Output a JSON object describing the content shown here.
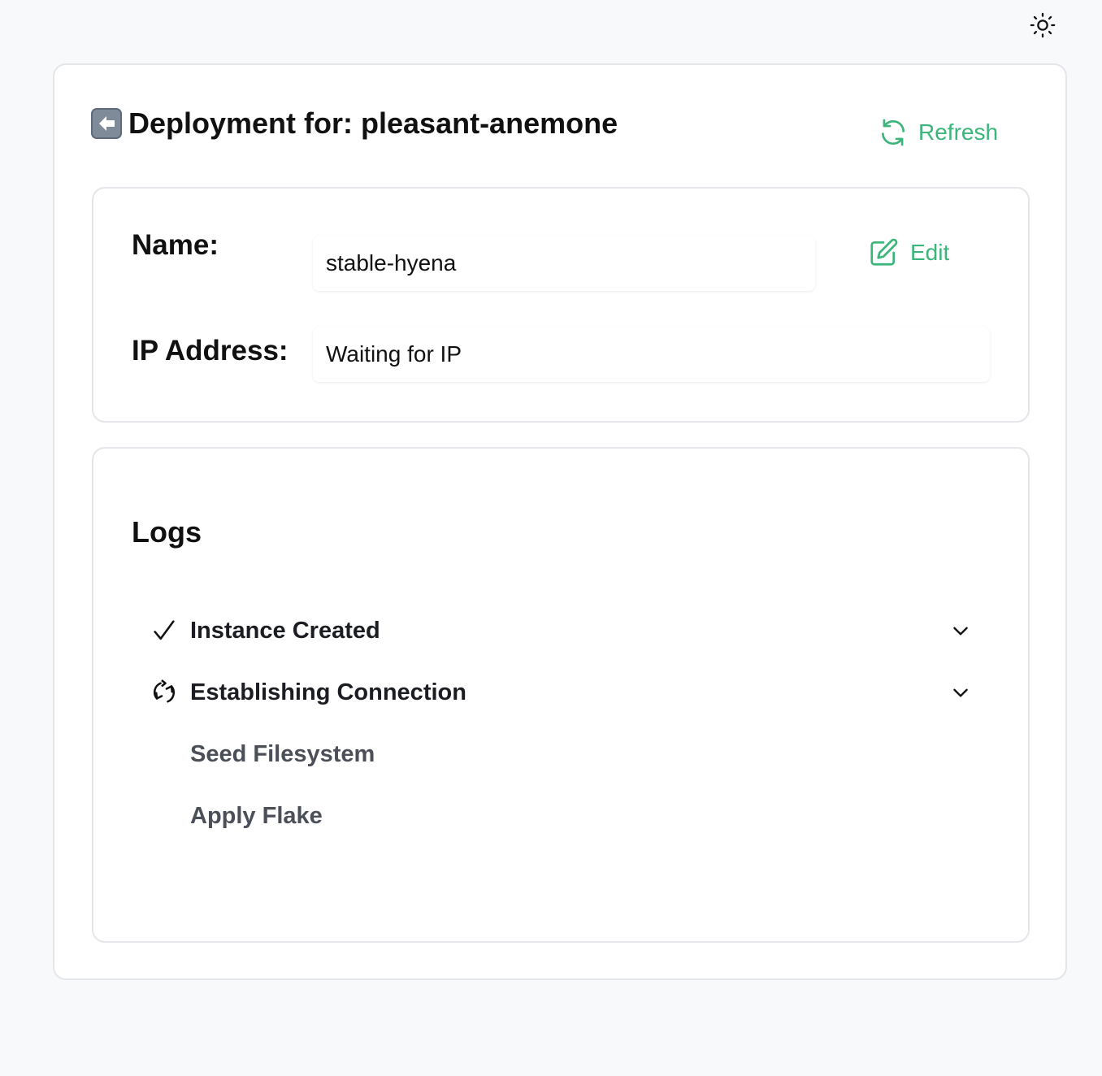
{
  "header": {
    "title": "Deployment for: pleasant-anemone",
    "refresh_label": "Refresh"
  },
  "theme_toggle": {
    "icon": "sun-icon"
  },
  "details": {
    "name_label": "Name:",
    "name_value": "stable-hyena",
    "edit_label": "Edit",
    "ip_label": "IP Address:",
    "ip_value": "Waiting for IP"
  },
  "logs": {
    "title": "Logs",
    "steps": [
      {
        "label": "Instance Created",
        "status": "done",
        "icon": "check-icon"
      },
      {
        "label": "Establishing Connection",
        "status": "in-progress",
        "icon": "sync-icon"
      },
      {
        "label": "Seed Filesystem",
        "status": "pending"
      },
      {
        "label": "Apply Flake",
        "status": "pending"
      }
    ]
  },
  "colors": {
    "accent": "#3bb57a",
    "background": "#f8f9fb",
    "card": "#ffffff",
    "border": "#e4e6ea"
  }
}
